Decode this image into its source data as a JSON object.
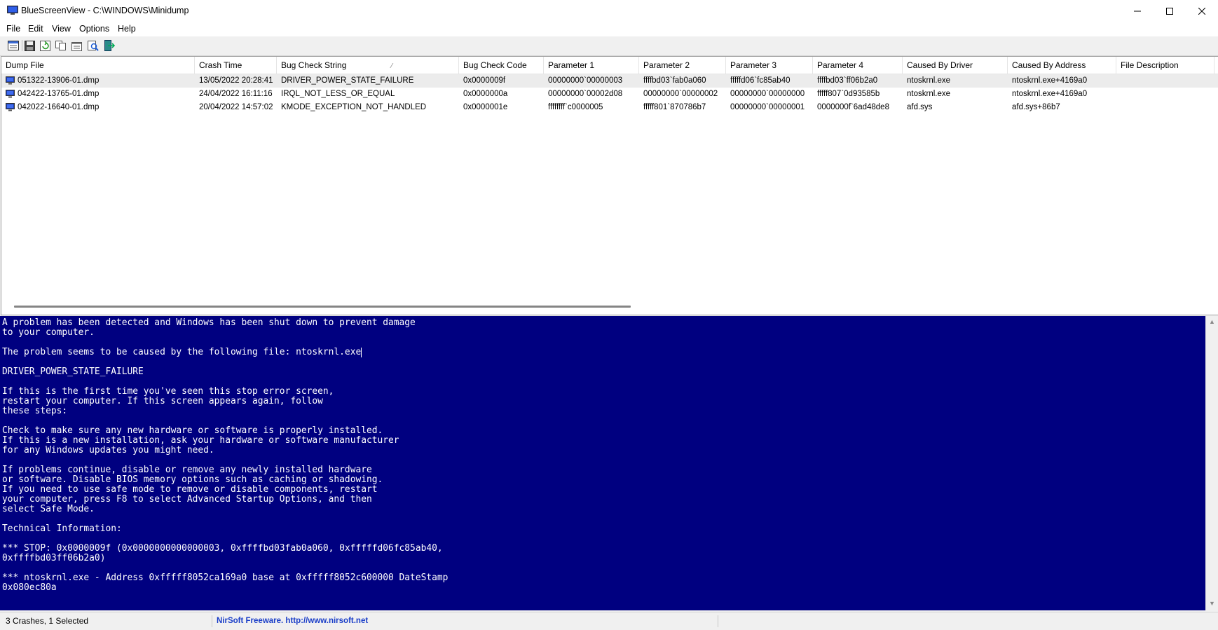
{
  "window": {
    "title": "BlueScreenView  -  C:\\WINDOWS\\Minidump"
  },
  "menu": [
    "File",
    "Edit",
    "View",
    "Options",
    "Help"
  ],
  "toolbar": {
    "icons": [
      "html-report-icon",
      "save-icon",
      "refresh-icon",
      "copy-icon",
      "properties-icon",
      "find-icon",
      "exit-icon"
    ]
  },
  "table": {
    "columns": [
      "Dump File",
      "Crash Time",
      "Bug Check String",
      "Bug Check Code",
      "Parameter 1",
      "Parameter 2",
      "Parameter 3",
      "Parameter 4",
      "Caused By Driver",
      "Caused By Address",
      "File Description"
    ],
    "sort_indicator": "⁄",
    "rows": [
      [
        "051322-13906-01.dmp",
        "13/05/2022 20:28:41",
        "DRIVER_POWER_STATE_FAILURE",
        "0x0000009f",
        "00000000`00000003",
        "ffffbd03`fab0a060",
        "fffffd06`fc85ab40",
        "ffffbd03`ff06b2a0",
        "ntoskrnl.exe",
        "ntoskrnl.exe+4169a0",
        ""
      ],
      [
        "042422-13765-01.dmp",
        "24/04/2022 16:11:16",
        "IRQL_NOT_LESS_OR_EQUAL",
        "0x0000000a",
        "00000000`00002d08",
        "00000000`00000002",
        "00000000`00000000",
        "fffff807`0d93585b",
        "ntoskrnl.exe",
        "ntoskrnl.exe+4169a0",
        ""
      ],
      [
        "042022-16640-01.dmp",
        "20/04/2022 14:57:02",
        "KMODE_EXCEPTION_NOT_HANDLED",
        "0x0000001e",
        "ffffffff`c0000005",
        "fffff801`870786b7",
        "00000000`00000001",
        "0000000f`6ad48de8",
        "afd.sys",
        "afd.sys+86b7",
        ""
      ]
    ]
  },
  "bsod": {
    "lines": [
      "A problem has been detected and Windows has been shut down to prevent damage",
      "to your computer.",
      "",
      "The problem seems to be caused by the following file: ntoskrnl.exe",
      "",
      "DRIVER_POWER_STATE_FAILURE",
      "",
      "If this is the first time you've seen this stop error screen,",
      "restart your computer. If this screen appears again, follow",
      "these steps:",
      "",
      "Check to make sure any new hardware or software is properly installed.",
      "If this is a new installation, ask your hardware or software manufacturer",
      "for any Windows updates you might need.",
      "",
      "If problems continue, disable or remove any newly installed hardware",
      "or software. Disable BIOS memory options such as caching or shadowing.",
      "If you need to use safe mode to remove or disable components, restart",
      "your computer, press F8 to select Advanced Startup Options, and then",
      "select Safe Mode.",
      "",
      "Technical Information:",
      "",
      "*** STOP: 0x0000009f (0x0000000000000003, 0xffffbd03fab0a060, 0xfffffd06fc85ab40,",
      "0xffffbd03ff06b2a0)",
      "",
      "*** ntoskrnl.exe - Address 0xfffff8052ca169a0 base at 0xfffff8052c600000 DateStamp",
      "0x080ec80a"
    ]
  },
  "status": {
    "count": "3 Crashes, 1 Selected",
    "credit": "NirSoft Freeware.  http://www.nirsoft.net"
  },
  "colors": {
    "bsod_background": "#000080",
    "bsod_text": "#ffffff",
    "link": "#1a3ec8"
  }
}
